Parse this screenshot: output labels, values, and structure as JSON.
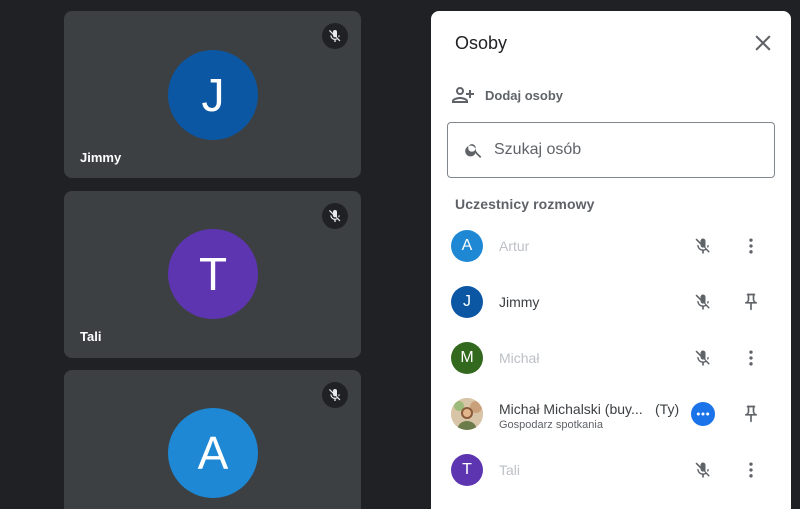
{
  "tiles": [
    {
      "initial": "J",
      "name": "Jimmy",
      "color": "#0b57a4"
    },
    {
      "initial": "T",
      "name": "Tali",
      "color": "#5e35b1"
    },
    {
      "initial": "A",
      "name": "",
      "color": "#1e88d4"
    }
  ],
  "panel": {
    "title": "Osoby",
    "add_label": "Dodaj osoby",
    "search_placeholder": "Szukaj osób",
    "section_heading": "Uczestnicy rozmowy",
    "participants": [
      {
        "initial": "A",
        "name": "Artur",
        "color": "#1e88d4",
        "state": "muted"
      },
      {
        "initial": "J",
        "name": "Jimmy",
        "color": "#0b57a4",
        "state": "active"
      },
      {
        "initial": "M",
        "name": "Michał",
        "color": "#33691e",
        "state": "muted"
      },
      {
        "name": "Michał Michalski (buy...",
        "suffix": "(Ty)",
        "subtitle": "Gospodarz spotkania",
        "state": "active"
      },
      {
        "initial": "T",
        "name": "Tali",
        "color": "#5e35b1",
        "state": "muted"
      }
    ]
  },
  "colors": {
    "background": "#202124",
    "tile": "#3c4043",
    "accent": "#1a73e8"
  }
}
